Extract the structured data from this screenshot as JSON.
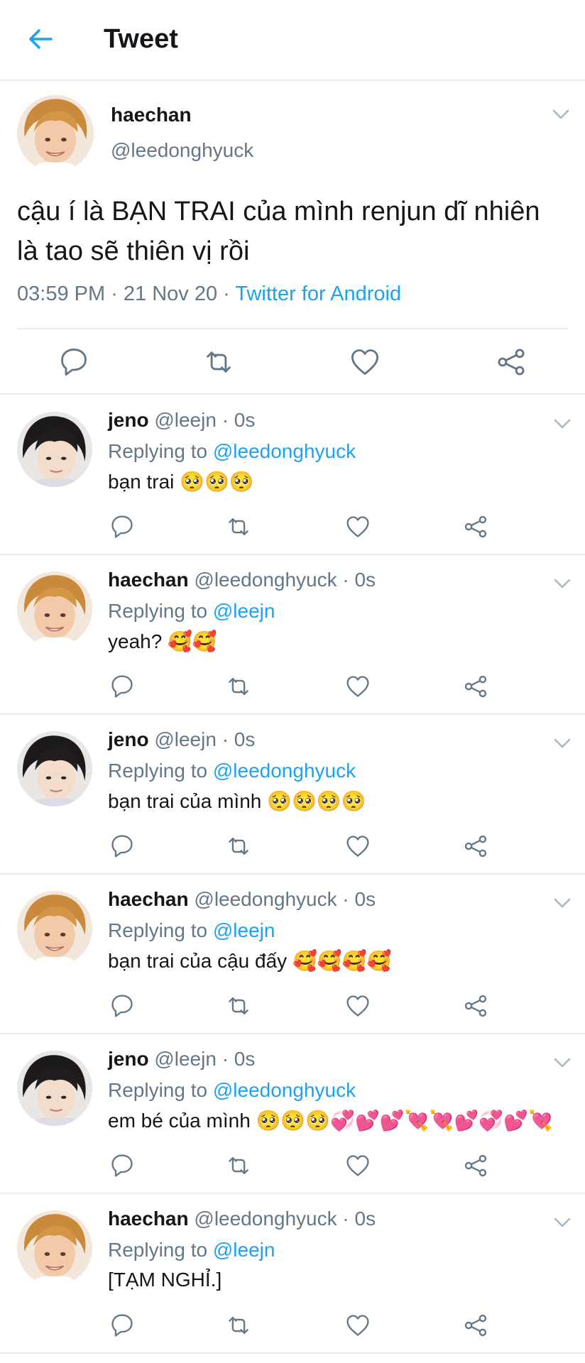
{
  "header": {
    "title": "Tweet"
  },
  "main_tweet": {
    "name": "haechan",
    "handle": "@leedonghyuck",
    "text": "cậu í là BẠN TRAI của mình renjun dĩ nhiên là tao sẽ thiên vị rồi",
    "time": "03:59 PM · 21 Nov 20 · ",
    "source": "Twitter for Android"
  },
  "replies": [
    {
      "name": "jeno",
      "handle": "@leejn · 0s",
      "replying_label": "Replying to ",
      "replying_to": "@leedonghyuck",
      "text": "bạn trai 🥺🥺🥺"
    },
    {
      "name": "haechan",
      "handle": "@leedonghyuck · 0s",
      "replying_label": "Replying to ",
      "replying_to": "@leejn",
      "text": "yeah? 🥰🥰"
    },
    {
      "name": "jeno",
      "handle": "@leejn · 0s",
      "replying_label": "Replying to ",
      "replying_to": "@leedonghyuck",
      "text": "bạn trai của mình 🥺🥺🥺🥺"
    },
    {
      "name": "haechan",
      "handle": "@leedonghyuck · 0s",
      "replying_label": "Replying to ",
      "replying_to": "@leejn",
      "text": "bạn trai của cậu đấy 🥰🥰🥰🥰"
    },
    {
      "name": "jeno",
      "handle": "@leejn · 0s",
      "replying_label": "Replying to ",
      "replying_to": "@leedonghyuck",
      "text": "em bé của mình 🥺🥺🥺💞💕💕💘💘💕💞💕💘"
    },
    {
      "name": "haechan",
      "handle": "@leedonghyuck · 0s",
      "replying_label": "Replying to ",
      "replying_to": "@leejn",
      "text": "[TẠM NGHỈ.]"
    }
  ],
  "colors": {
    "accent": "#1da1f2",
    "secondary_text": "#657786",
    "divider": "#e6ecf0"
  }
}
